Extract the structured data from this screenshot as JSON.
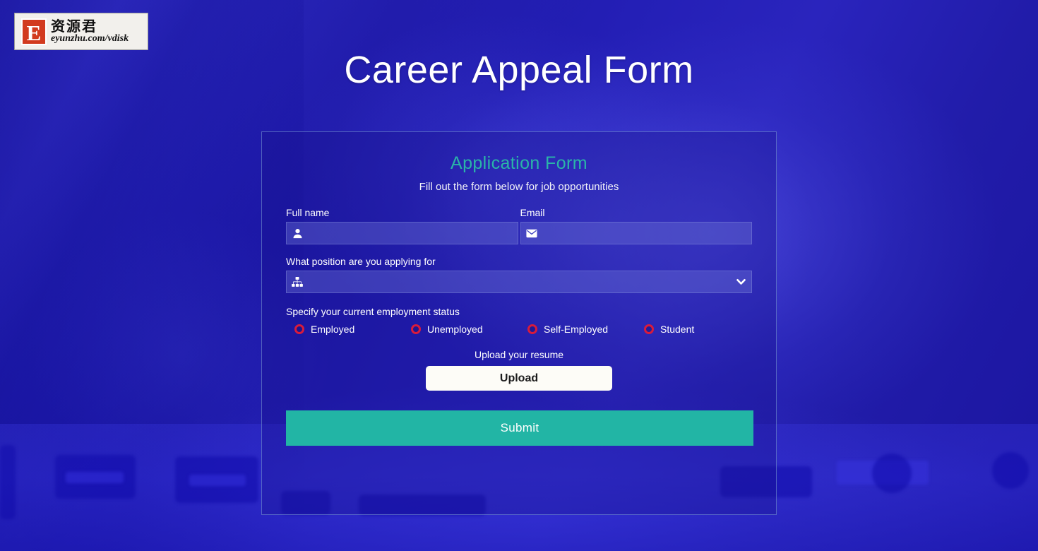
{
  "watermark": {
    "letter": "E",
    "brand_cn": "资源君",
    "url": "eyunzhu.com/vdisk"
  },
  "page": {
    "title": "Career Appeal Form"
  },
  "form": {
    "heading": "Application Form",
    "subtitle": "Fill out the form below for job opportunities",
    "fields": {
      "full_name": {
        "label": "Full name",
        "value": "",
        "placeholder": "",
        "icon": "user-icon"
      },
      "email": {
        "label": "Email",
        "value": "",
        "placeholder": "",
        "icon": "envelope-icon"
      },
      "position": {
        "label": "What position are you applying for",
        "selected": "",
        "icon": "sitemap-icon",
        "chevron": "chevron-down-icon",
        "options": [
          ""
        ]
      },
      "employment_status": {
        "label": "Specify your current employment status",
        "selected": "",
        "options": [
          {
            "label": "Employed",
            "checked": false
          },
          {
            "label": "Unemployed",
            "checked": false
          },
          {
            "label": "Self-Employed",
            "checked": false
          },
          {
            "label": "Student",
            "checked": false
          }
        ]
      },
      "resume": {
        "label": "Upload your resume",
        "button_label": "Upload"
      }
    },
    "submit_label": "Submit"
  },
  "colors": {
    "accent_teal": "#22b5a5",
    "heading_teal": "#2ab5a8",
    "radio_red": "#d81b3c",
    "background_blue": "#2020c8",
    "upload_white": "#fdfcf7",
    "card_border": "#7ea0d7"
  }
}
